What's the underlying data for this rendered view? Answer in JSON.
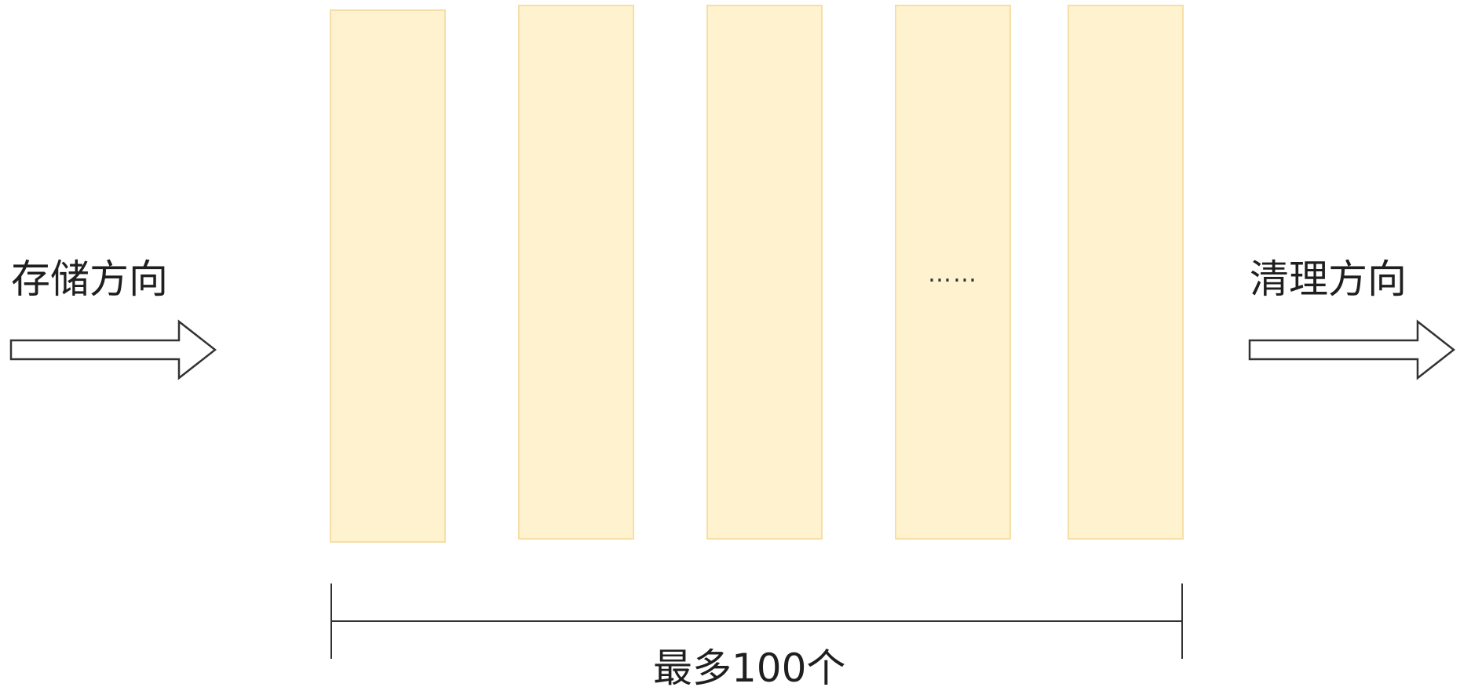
{
  "diagram": {
    "storage_direction_label": "存储方向",
    "cleanup_direction_label": "清理方向",
    "ellipsis_text": "……",
    "max_count_label": "最多100个",
    "box_count_shown": 5,
    "colors": {
      "box_fill": "#fff2cf",
      "box_border": "#f6dfa6",
      "line": "#333333",
      "arrow_stroke": "#333333"
    }
  }
}
